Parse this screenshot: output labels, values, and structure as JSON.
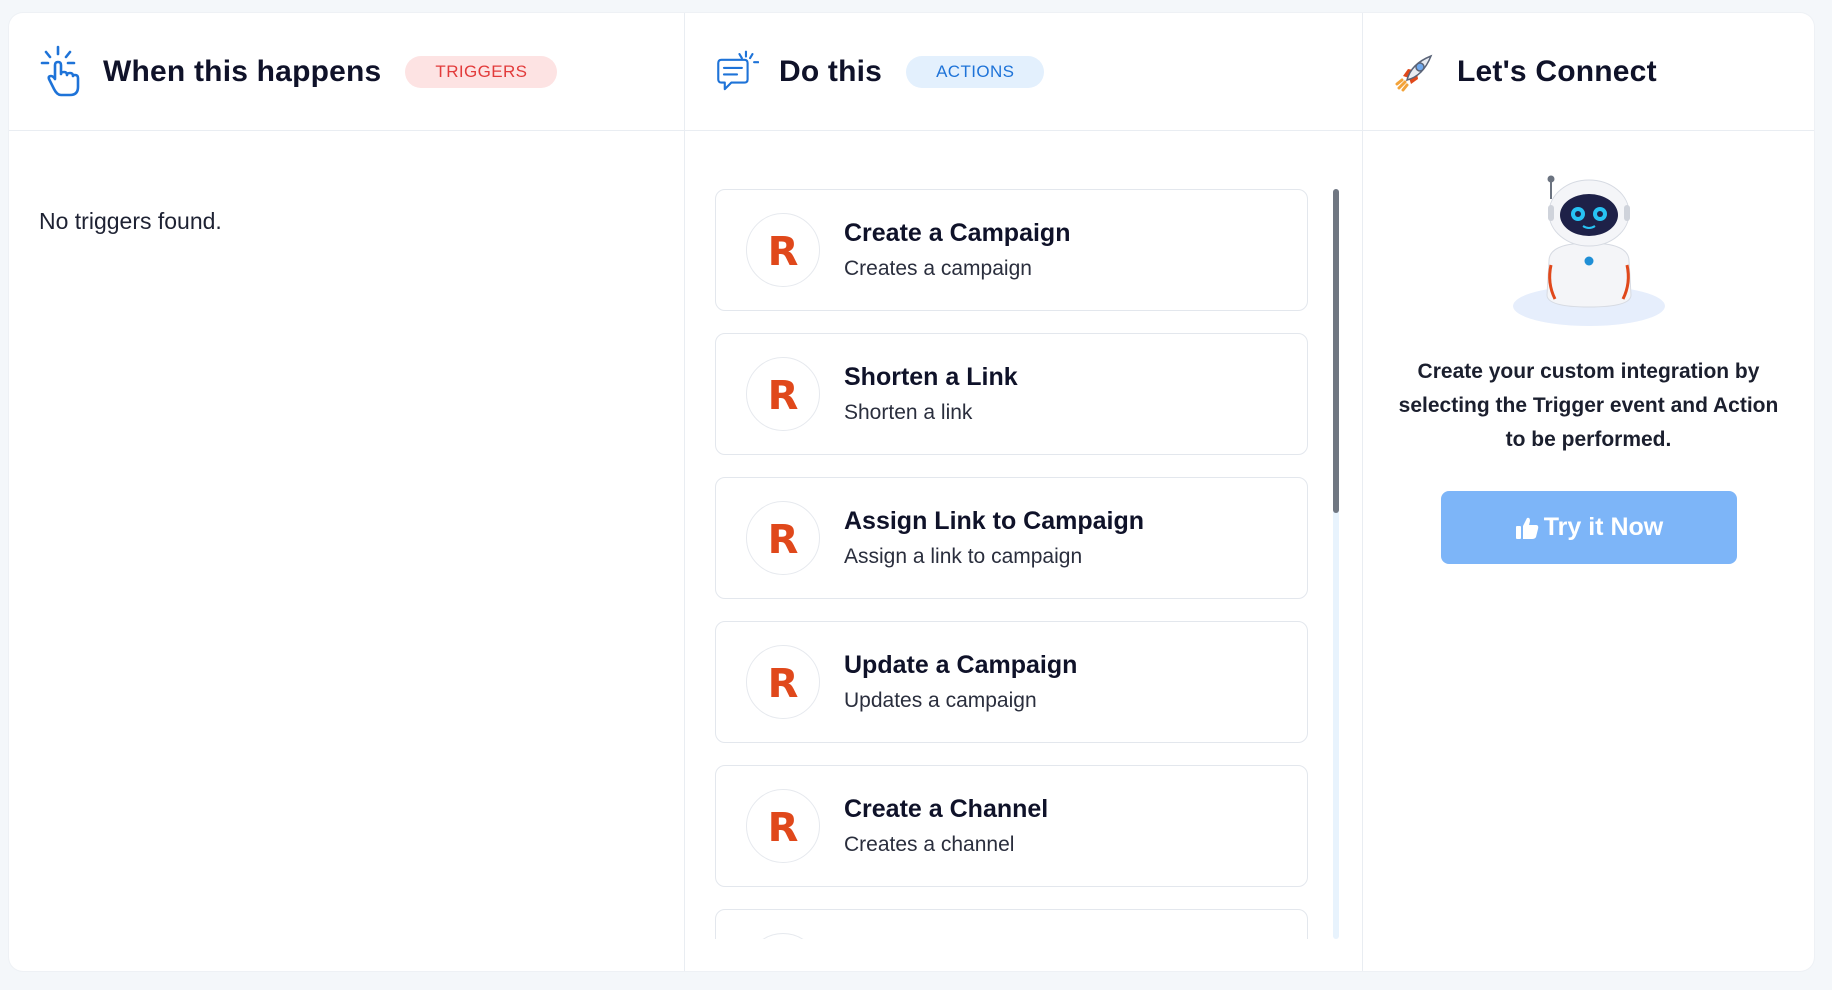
{
  "triggers": {
    "title": "When this happens",
    "badge": "TRIGGERS",
    "empty_message": "No triggers found.",
    "icon": "hand-pointer-click-icon"
  },
  "actions": {
    "title": "Do this",
    "badge": "ACTIONS",
    "icon": "chat-message-icon",
    "app_logo_letter": "R",
    "items": [
      {
        "title": "Create a Campaign",
        "description": "Creates a campaign"
      },
      {
        "title": "Shorten a Link",
        "description": "Shorten a link"
      },
      {
        "title": "Assign Link to Campaign",
        "description": "Assign a link to campaign"
      },
      {
        "title": "Update a Campaign",
        "description": "Updates a campaign"
      },
      {
        "title": "Create a Channel",
        "description": "Creates a channel"
      }
    ]
  },
  "connect": {
    "title": "Let's Connect",
    "icon": "rocket-icon",
    "description": "Create your custom integration by selecting the Trigger event and Action to be performed.",
    "button_label": "Try it Now",
    "button_icon": "thumbs-up-icon"
  },
  "colors": {
    "triggers_badge_bg": "#fde3e3",
    "triggers_badge_text": "#e23b3b",
    "actions_badge_bg": "#e3f0fd",
    "actions_badge_text": "#1e73d8",
    "app_logo": "#e0481b",
    "button_bg": "#7db5f8"
  }
}
